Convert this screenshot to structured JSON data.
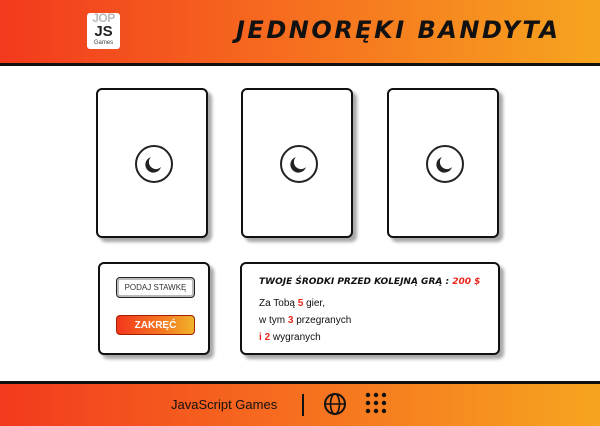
{
  "header": {
    "logo_top": "JOP",
    "logo_main": "JS",
    "logo_sub": "Games",
    "title": "Jednoręki bandyta"
  },
  "reels": [
    {
      "symbol_icon": "moon-icon"
    },
    {
      "symbol_icon": "moon-icon"
    },
    {
      "symbol_icon": "moon-icon"
    }
  ],
  "controls": {
    "stake_placeholder": "PODAJ STAWKĘ",
    "stake_value": "",
    "spin_label": "ZAKRĘĆ"
  },
  "stats": {
    "funds_label": "Twoje środki przed kolejną grą :",
    "funds_amount": "200 $",
    "games_prefix": "Za Tobą",
    "games_count": "5",
    "games_suffix": "gier,",
    "lost_prefix": "w tym",
    "lost_count": "3",
    "lost_suffix": "przegranych",
    "won_prefix": "i",
    "won_count": "2",
    "won_suffix": "wygranych"
  },
  "footer": {
    "brand": "JavaScript Games",
    "icons": [
      "globe-icon",
      "apps-grid-icon"
    ]
  },
  "colors": {
    "accent_start": "#f23a1d",
    "accent_end": "#f6a51f",
    "highlight": "#e8271b"
  }
}
